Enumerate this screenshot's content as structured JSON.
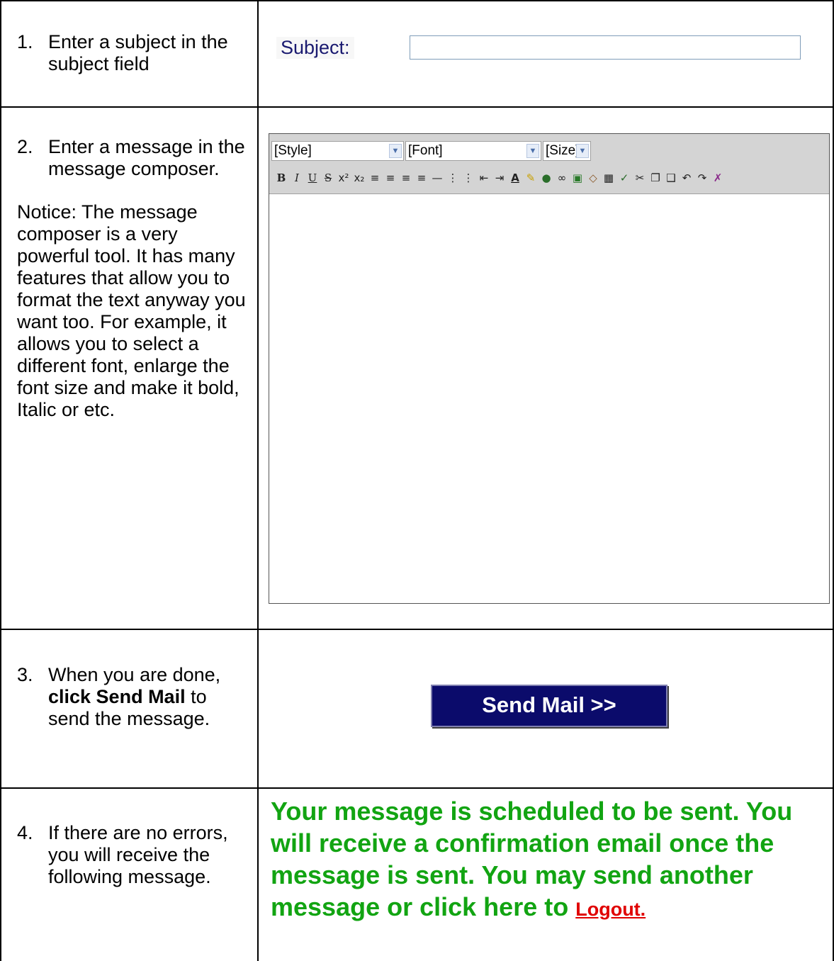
{
  "steps": [
    {
      "num": "1.",
      "text": "Enter a subject in the subject field"
    },
    {
      "num": "2.",
      "text": "Enter a message in the message composer.",
      "notice": "Notice:  The message composer is a very powerful tool.  It has many features that allow you to format the text anyway you want too.  For example, it allows you to select a different font, enlarge the font size and make it bold, Italic or etc."
    },
    {
      "num": "3.",
      "text_before": "When you are done, ",
      "text_bold": "click Send Mail",
      "text_after": " to send the message."
    },
    {
      "num": "4.",
      "text": "If there are no errors, you will receive the following message."
    }
  ],
  "subject": {
    "label": "Subject:",
    "value": ""
  },
  "editor": {
    "style_select": "[Style]",
    "font_select": "[Font]",
    "size_select": "[Size]",
    "toolbar_icons": [
      "bold-icon",
      "italic-icon",
      "underline-icon",
      "strikethrough-icon",
      "superscript-icon",
      "subscript-icon",
      "align-left-icon",
      "align-center-icon",
      "align-right-icon",
      "justify-icon",
      "horizontal-rule-icon",
      "ordered-list-icon",
      "unordered-list-icon",
      "outdent-icon",
      "indent-icon",
      "text-color-icon",
      "highlight-icon",
      "web-link-icon",
      "link-icon",
      "image-icon",
      "object-icon",
      "table-icon",
      "spellcheck-icon",
      "cut-icon",
      "copy-icon",
      "paste-icon",
      "undo-icon",
      "redo-icon",
      "remove-format-icon"
    ],
    "body_text": ""
  },
  "send_button": {
    "label": "Send Mail >>"
  },
  "confirmation": {
    "text": "Your message is scheduled to be sent.  You will receive a confirmation email once the message is sent. You may send another message or click here to ",
    "logout_label": "Logout."
  },
  "colors": {
    "confirmation_green": "#12a412",
    "logout_red": "#e00000",
    "button_navy": "#0b0b6b",
    "subject_label": "#1a1a70"
  }
}
